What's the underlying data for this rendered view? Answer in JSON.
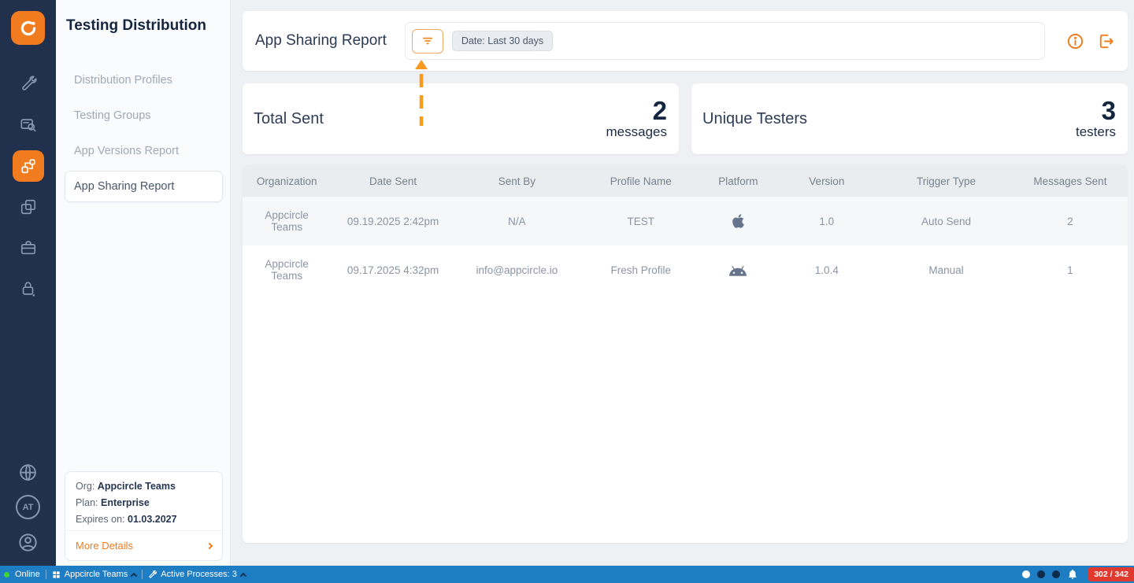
{
  "colors": {
    "accent_orange": "#f07c1f",
    "rail_navy": "#20304d",
    "statusbar_blue": "#1f7dc4",
    "badge_red": "#e03a2f",
    "online_green": "#3ed32f"
  },
  "rail": {
    "avatar_initials": "AT",
    "items": [
      {
        "name": "build",
        "active": false
      },
      {
        "name": "signing-identities",
        "active": false
      },
      {
        "name": "testing-distribution",
        "active": true
      },
      {
        "name": "publish",
        "active": false
      },
      {
        "name": "enterprise-app-store",
        "active": false
      },
      {
        "name": "license",
        "active": false
      }
    ]
  },
  "sidebar": {
    "title": "Testing Distribution",
    "items": [
      {
        "label": "Distribution Profiles",
        "active": false
      },
      {
        "label": "Testing Groups",
        "active": false
      },
      {
        "label": "App Versions Report",
        "active": false
      },
      {
        "label": "App Sharing Report",
        "active": true
      }
    ],
    "org_box": {
      "org_label": "Org:",
      "org_value": "Appcircle Teams",
      "plan_label": "Plan:",
      "plan_value": "Enterprise",
      "expires_label": "Expires on:",
      "expires_value": "01.03.2027",
      "more_details_label": "More Details"
    }
  },
  "header": {
    "title": "App Sharing Report",
    "date_filter_chip": "Date: Last 30 days"
  },
  "stats": [
    {
      "label": "Total Sent",
      "value": "2",
      "unit": "messages"
    },
    {
      "label": "Unique Testers",
      "value": "3",
      "unit": "testers"
    }
  ],
  "table": {
    "columns": [
      "Organization",
      "Date Sent",
      "Sent By",
      "Profile Name",
      "Platform",
      "Version",
      "Trigger Type",
      "Messages Sent"
    ],
    "rows": [
      {
        "organization": "Appcircle Teams",
        "date_sent": "09.19.2025 2:42pm",
        "sent_by": "N/A",
        "profile_name": "TEST",
        "platform": "apple",
        "version": "1.0",
        "trigger_type": "Auto Send",
        "messages_sent": "2"
      },
      {
        "organization": "Appcircle Teams",
        "date_sent": "09.17.2025 4:32pm",
        "sent_by": "info@appcircle.io",
        "profile_name": "Fresh Profile",
        "platform": "android",
        "version": "1.0.4",
        "trigger_type": "Manual",
        "messages_sent": "1"
      }
    ]
  },
  "statusbar": {
    "online_label": "Online",
    "org_label": "Appcircle Teams",
    "processes_label": "Active Processes: 3",
    "usage_badge": "302 / 342"
  },
  "icons": {
    "filter": "filter-lines",
    "info": "info-circle",
    "export": "export-arrow",
    "apple": "apple-logo",
    "android": "android-robot",
    "annotation": "orange-dashed-up-arrow",
    "bell": "bell"
  }
}
